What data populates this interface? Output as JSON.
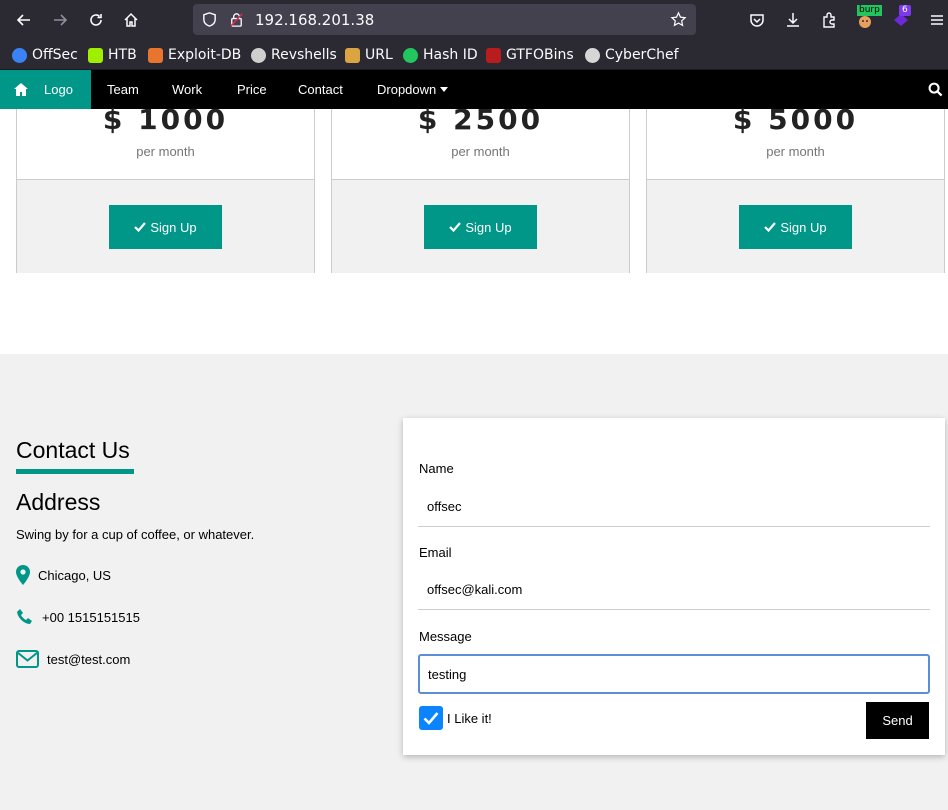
{
  "browser": {
    "url": "192.168.201.38",
    "extensions": {
      "burp_badge": "burp",
      "notification_count": "6"
    },
    "bookmarks": [
      {
        "label": "OffSec",
        "icon": "offsec-icon",
        "color": "#3b82f6"
      },
      {
        "label": "HTB",
        "icon": "htb-icon",
        "color": "#9fef00"
      },
      {
        "label": "Exploit-DB",
        "icon": "exploit-db-icon",
        "color": "#e8742e"
      },
      {
        "label": "Revshells",
        "icon": "skull-icon",
        "color": "#cfcfcf"
      },
      {
        "label": "URL",
        "icon": "url-icon",
        "color": "#d9a441"
      },
      {
        "label": "Hash ID",
        "icon": "hash-id-icon",
        "color": "#22c55e"
      },
      {
        "label": "GTFOBins",
        "icon": "gtfobins-icon",
        "color": "#b91c1c"
      },
      {
        "label": "CyberChef",
        "icon": "cyberchef-icon",
        "color": "#d6d6d6"
      }
    ]
  },
  "navbar": {
    "logo": "Logo",
    "items": [
      "Team",
      "Work",
      "Price",
      "Contact"
    ],
    "dropdown": "Dropdown",
    "accent": "#009688"
  },
  "pricing": {
    "plans": [
      {
        "price": "$ 1000",
        "period": "per month",
        "button": "Sign Up"
      },
      {
        "price": "$ 2500",
        "period": "per month",
        "button": "Sign Up"
      },
      {
        "price": "$ 5000",
        "period": "per month",
        "button": "Sign Up"
      }
    ]
  },
  "contact": {
    "heading": "Contact Us",
    "address_heading": "Address",
    "tagline": "Swing by for a cup of coffee, or whatever.",
    "location": "Chicago, US",
    "phone": "+00 1515151515",
    "email": "test@test.com"
  },
  "form": {
    "name_label": "Name",
    "name_value": "offsec",
    "email_label": "Email",
    "email_value": "offsec@kali.com",
    "message_label": "Message",
    "message_value": "testing",
    "checkbox_label": "I Like it!",
    "checkbox_checked": true,
    "send_label": "Send"
  }
}
